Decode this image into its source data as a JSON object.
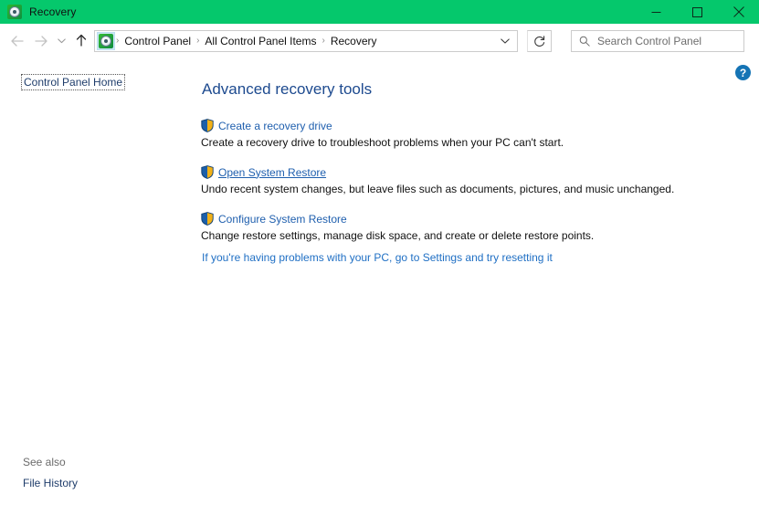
{
  "window": {
    "title": "Recovery",
    "icon": "recovery-disc-icon",
    "titlebar_color": "#05c86c",
    "controls": {
      "minimize": "minimize-icon",
      "maximize": "maximize-icon",
      "close": "close-icon"
    }
  },
  "toolbar": {
    "back": "back-arrow-icon",
    "forward": "forward-arrow-icon",
    "recent": "chevron-down-icon",
    "up": "up-arrow-icon",
    "address_icon": "recovery-disc-icon",
    "breadcrumbs": [
      "Control Panel",
      "All Control Panel Items",
      "Recovery"
    ],
    "separator": "›",
    "dropdown": "chevron-down-icon",
    "refresh": "refresh-icon",
    "search": {
      "icon": "search-icon",
      "placeholder": "Search Control Panel",
      "value": ""
    }
  },
  "sidebar": {
    "control_panel_home": "Control Panel Home",
    "see_also_label": "See also",
    "file_history": "File History"
  },
  "content": {
    "help_button": "?",
    "page_title": "Advanced recovery tools",
    "tools": [
      {
        "icon": "uac-shield-icon",
        "link": "Create a recovery drive",
        "description": "Create a recovery drive to troubleshoot problems when your PC can't start.",
        "hovered": false
      },
      {
        "icon": "uac-shield-icon",
        "link": "Open System Restore",
        "description": "Undo recent system changes, but leave files such as documents, pictures, and music unchanged.",
        "hovered": true
      },
      {
        "icon": "uac-shield-icon",
        "link": "Configure System Restore",
        "description": "Change restore settings, manage disk space, and create or delete restore points.",
        "hovered": false
      }
    ],
    "settings_link": "If you're having problems with your PC, go to Settings and try resetting it"
  },
  "colors": {
    "titlebar_green": "#05c86c",
    "link_blue": "#1f5fae",
    "heading_blue": "#1d4a8f",
    "sidebar_link": "#1f3d6b",
    "help_blue": "#1574b5"
  }
}
